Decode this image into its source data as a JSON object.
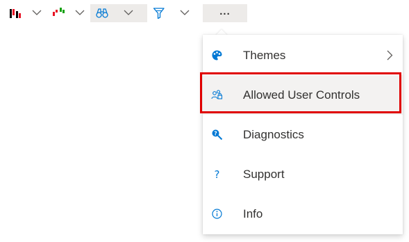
{
  "toolbar": {
    "items": [
      {
        "icon": "candlestick-chart-icon"
      },
      {
        "icon": "ohlc-chart-icon"
      },
      {
        "icon": "binoculars-icon"
      },
      {
        "icon": "funnel-icon"
      }
    ],
    "more_label": "..."
  },
  "menu": {
    "items": [
      {
        "label": "Themes",
        "icon": "palette-icon",
        "has_submenu": true
      },
      {
        "label": "Allowed User Controls",
        "icon": "user-permissions-icon",
        "selected": true
      },
      {
        "label": "Diagnostics",
        "icon": "diagnostics-search-icon"
      },
      {
        "label": "Support",
        "icon": "question-icon"
      },
      {
        "label": "Info",
        "icon": "info-icon"
      }
    ]
  },
  "colors": {
    "accent": "#0078d4",
    "highlight_border": "#e00000",
    "chart_red": "#e81123",
    "chart_green": "#13a10e"
  }
}
